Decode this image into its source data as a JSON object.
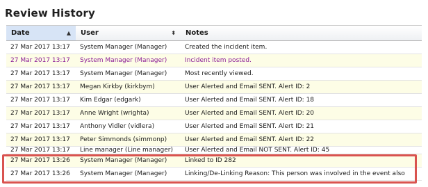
{
  "page": {
    "title": "Review History"
  },
  "table": {
    "headers": {
      "date": "Date",
      "user": "User",
      "notes": "Notes"
    },
    "sort_icons": {
      "date": "▲",
      "user": "⬍"
    },
    "rows": [
      {
        "date": "27 Mar 2017 13:17",
        "user": "System Manager (Manager)",
        "notes": "Created the incident item."
      },
      {
        "date": "27 Mar 2017 13:17",
        "user": "System Manager (Manager)",
        "notes": "Incident item posted."
      },
      {
        "date": "27 Mar 2017 13:17",
        "user": "System Manager (Manager)",
        "notes": "Most recently viewed."
      },
      {
        "date": "27 Mar 2017 13:17",
        "user": "Megan Kirkby (kirkbym)",
        "notes": "User Alerted and Email SENT. Alert ID: 2"
      },
      {
        "date": "27 Mar 2017 13:17",
        "user": "Kim Edgar (edgark)",
        "notes": "User Alerted and Email SENT. Alert ID: 18"
      },
      {
        "date": "27 Mar 2017 13:17",
        "user": "Anne Wright (wrighta)",
        "notes": "User Alerted and Email SENT. Alert ID: 20"
      },
      {
        "date": "27 Mar 2017 13:17",
        "user": "Anthony Vidler (vidlera)",
        "notes": "User Alerted and Email SENT. Alert ID: 21"
      },
      {
        "date": "27 Mar 2017 13:17",
        "user": "Peter Simmonds (simmonp)",
        "notes": "User Alerted and Email SENT. Alert ID: 22"
      },
      {
        "date": "27 Mar 2017 13:17",
        "user": "Line manager (Line manager)",
        "notes": "User Alerted and Email NOT SENT. Alert ID: 45"
      },
      {
        "date": "27 Mar 2017 13:26",
        "user": "System Manager (Manager)",
        "notes": "Linked to ID 282"
      },
      {
        "date": "27 Mar 2017 13:26",
        "user": "System Manager (Manager)",
        "notes": "Linking/De-Linking Reason: This person was involved in the event also"
      }
    ]
  },
  "colors": {
    "highlight_border": "#d9534f",
    "posted_row_text": "#8b1d96",
    "alt_row": "#fdfde6"
  }
}
